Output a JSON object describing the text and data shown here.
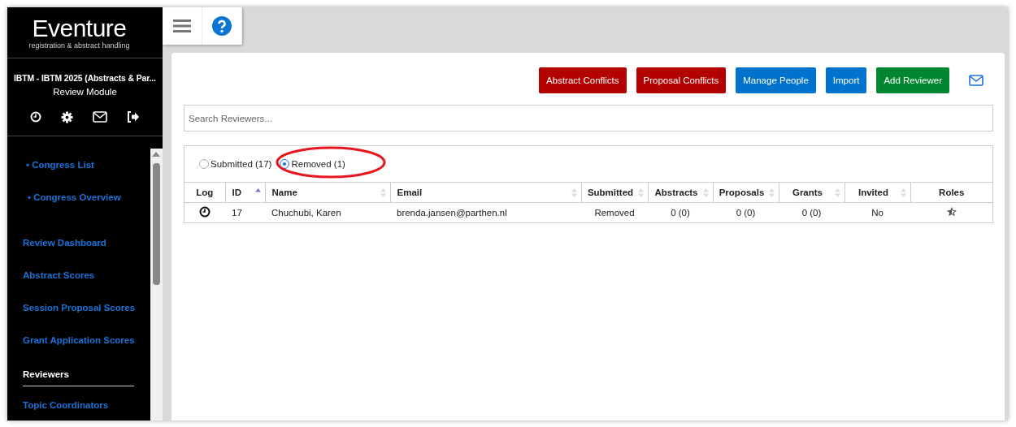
{
  "brand": {
    "logo": "Eventure",
    "tagline": "registration & abstract handling"
  },
  "congress": {
    "title": "IBTM - IBTM 2025 (Abstracts & Par...",
    "module": "Review Module"
  },
  "sidebar": {
    "items": [
      {
        "label": "• Congress List",
        "kind": "sub",
        "selected": false
      },
      {
        "label": "• Congress Overview",
        "kind": "sub",
        "selected": false
      },
      {
        "label": "Review Dashboard",
        "kind": "main",
        "selected": false
      },
      {
        "label": "Abstract Scores",
        "kind": "main",
        "selected": false
      },
      {
        "label": "Session Proposal Scores",
        "kind": "main",
        "selected": false
      },
      {
        "label": "Grant Application Scores",
        "kind": "main",
        "selected": false
      },
      {
        "label": "Reviewers",
        "kind": "main",
        "selected": true
      },
      {
        "label": "Topic Coordinators",
        "kind": "main",
        "selected": false
      }
    ]
  },
  "buttons": [
    {
      "label": "Abstract Conflicts",
      "color": "#b30000"
    },
    {
      "label": "Proposal Conflicts",
      "color": "#b30000"
    },
    {
      "label": "Manage People",
      "color": "#0073cf"
    },
    {
      "label": "Import",
      "color": "#0073cf"
    },
    {
      "label": "Add Reviewer",
      "color": "#00862e"
    }
  ],
  "search": {
    "placeholder": "Search Reviewers..."
  },
  "filters": [
    {
      "label": "Submitted (17)",
      "selected": false
    },
    {
      "label": "Removed (1)",
      "selected": true
    }
  ],
  "table": {
    "columns": [
      {
        "label": "Log",
        "sortable": false,
        "sorted": false
      },
      {
        "label": "ID",
        "sortable": true,
        "sorted": true
      },
      {
        "label": "Name",
        "sortable": true,
        "sorted": false
      },
      {
        "label": "Email",
        "sortable": true,
        "sorted": false
      },
      {
        "label": "Submitted",
        "sortable": true,
        "sorted": false
      },
      {
        "label": "Abstracts",
        "sortable": true,
        "sorted": false
      },
      {
        "label": "Proposals",
        "sortable": true,
        "sorted": false
      },
      {
        "label": "Grants",
        "sortable": true,
        "sorted": false
      },
      {
        "label": "Invited",
        "sortable": true,
        "sorted": false
      },
      {
        "label": "Roles",
        "sortable": false,
        "sorted": false
      }
    ],
    "rows": [
      {
        "cells": [
          "",
          "17",
          "Chuchubi, Karen",
          "brenda.jansen@parthen.nl",
          "Removed",
          "0 (0)",
          "0 (0)",
          "0 (0)",
          "No",
          ""
        ]
      }
    ]
  }
}
